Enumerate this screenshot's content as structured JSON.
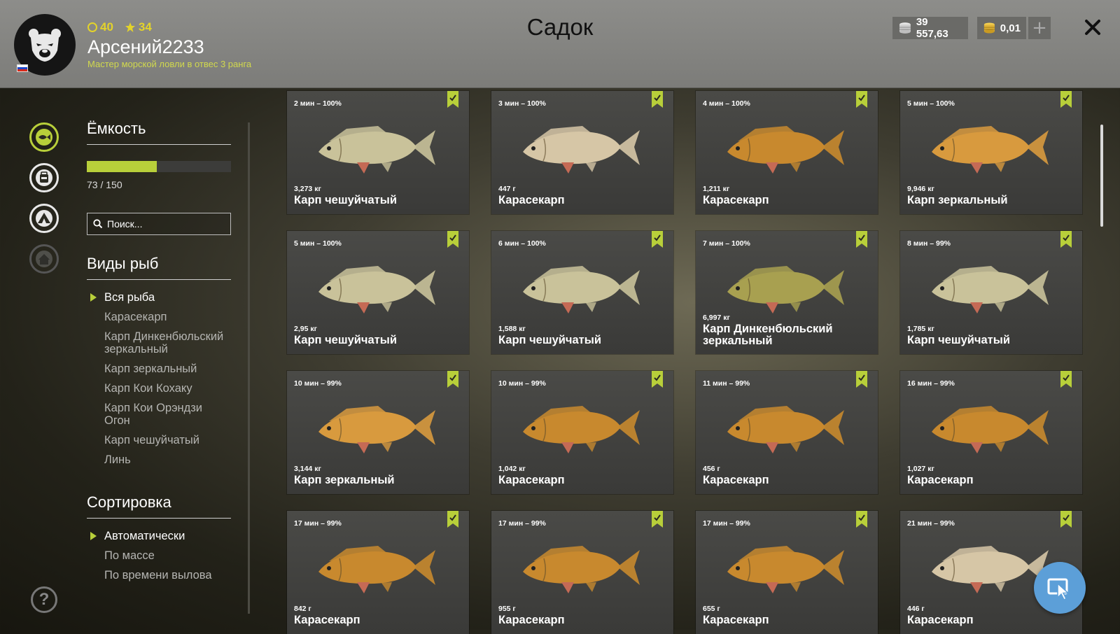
{
  "header": {
    "title": "Садок",
    "username": "Арсений2233",
    "rank_text": "Мастер морской ловли в отвес 3 ранга",
    "level": "40",
    "stars": "34",
    "silver": "39 557,63",
    "gold": "0,01"
  },
  "nav": {
    "icons": [
      "fish-keepnet-icon",
      "backpack-icon",
      "camp-tent-icon",
      "home-icon"
    ],
    "help": "?"
  },
  "capacity": {
    "title": "Ёмкость",
    "text": "73 / 150",
    "fill_fraction": 0.487,
    "accent": "#b8cf3a"
  },
  "search": {
    "placeholder": "Поиск..."
  },
  "species": {
    "title": "Виды рыб",
    "items": [
      "Вся рыба",
      "Карасекарп",
      "Карп Динкенбюльский зеркальный",
      "Карп зеркальный",
      "Карп Кои Кохаку",
      "Карп Кои Орэндзи Огон",
      "Карп чешуйчатый",
      "Линь"
    ]
  },
  "sorting": {
    "title": "Сортировка",
    "items": [
      "Автоматически",
      "По массе",
      "По времени вылова"
    ]
  },
  "fish": [
    {
      "time": "2 мин – 100%",
      "weight": "3,273 кг",
      "name": "Карп чешуйчатый",
      "color": "#c9c29a"
    },
    {
      "time": "3 мин – 100%",
      "weight": "447 г",
      "name": "Карасекарп",
      "color": "#d6c6a6"
    },
    {
      "time": "4 мин – 100%",
      "weight": "1,211 кг",
      "name": "Карасекарп",
      "color": "#c8892e"
    },
    {
      "time": "5 мин – 100%",
      "weight": "9,946 кг",
      "name": "Карп зеркальный",
      "color": "#d89a3e"
    },
    {
      "time": "5 мин – 100%",
      "weight": "2,95 кг",
      "name": "Карп чешуйчатый",
      "color": "#c9c29a"
    },
    {
      "time": "6 мин – 100%",
      "weight": "1,588 кг",
      "name": "Карп чешуйчатый",
      "color": "#c9c29a"
    },
    {
      "time": "7 мин – 100%",
      "weight": "6,997 кг",
      "name": "Карп Динкенбюльский зеркальный",
      "color": "#a8a050"
    },
    {
      "time": "8 мин – 99%",
      "weight": "1,785 кг",
      "name": "Карп чешуйчатый",
      "color": "#c9c29a"
    },
    {
      "time": "10 мин – 99%",
      "weight": "3,144 кг",
      "name": "Карп зеркальный",
      "color": "#d89a3e"
    },
    {
      "time": "10 мин – 99%",
      "weight": "1,042 кг",
      "name": "Карасекарп",
      "color": "#c8892e"
    },
    {
      "time": "11 мин – 99%",
      "weight": "456 г",
      "name": "Карасекарп",
      "color": "#c8892e"
    },
    {
      "time": "16 мин – 99%",
      "weight": "1,027 кг",
      "name": "Карасекарп",
      "color": "#c8892e"
    },
    {
      "time": "17 мин – 99%",
      "weight": "842 г",
      "name": "Карасекарп",
      "color": "#c8892e"
    },
    {
      "time": "17 мин – 99%",
      "weight": "955 г",
      "name": "Карасекарп",
      "color": "#c8892e"
    },
    {
      "time": "17 мин – 99%",
      "weight": "655 г",
      "name": "Карасекарп",
      "color": "#c8892e"
    },
    {
      "time": "21 мин – 99%",
      "weight": "446 г",
      "name": "Карасекарп",
      "color": "#d6c6a6"
    }
  ]
}
